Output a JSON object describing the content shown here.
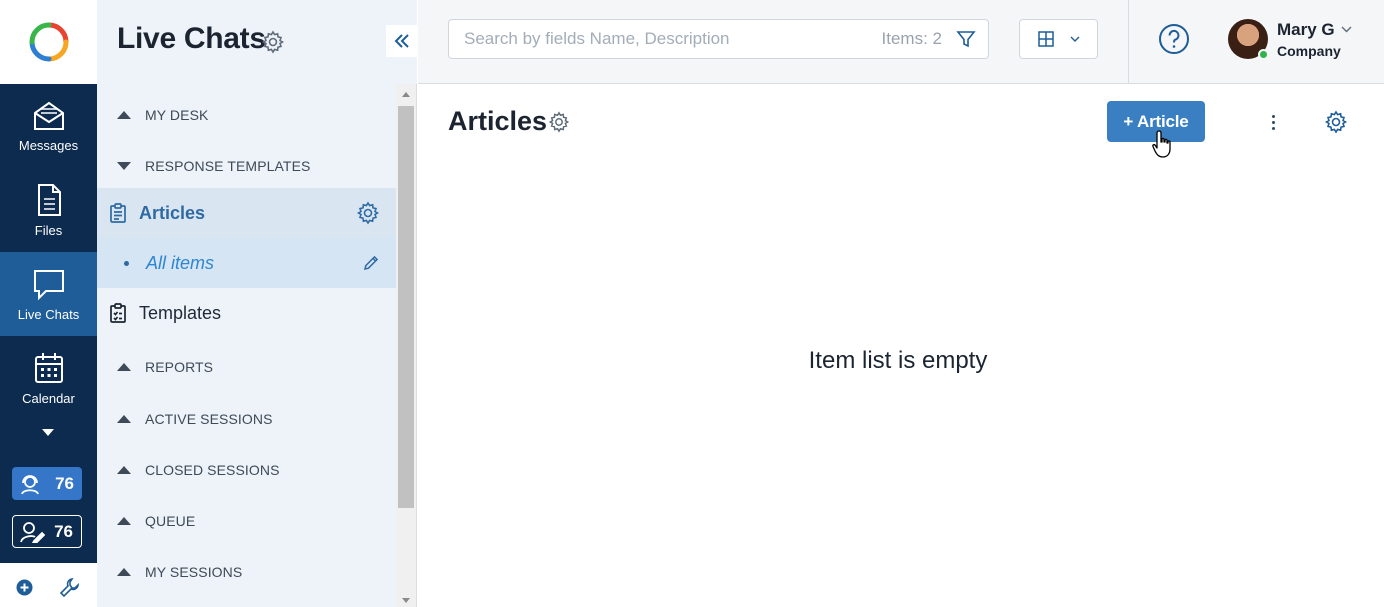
{
  "rail": {
    "items": [
      {
        "label": "Messages",
        "icon": "envelope-icon"
      },
      {
        "label": "Files",
        "icon": "file-icon"
      },
      {
        "label": "Live Chats",
        "icon": "chat-bubble-icon",
        "active": true
      },
      {
        "label": "Calendar",
        "icon": "calendar-icon"
      }
    ],
    "badges": [
      {
        "icon": "operator-headset-icon",
        "count": "76"
      },
      {
        "icon": "user-edit-icon",
        "count": "76"
      }
    ]
  },
  "nav": {
    "title": "Live Chats",
    "items": [
      {
        "type": "section",
        "label": "MY DESK",
        "state": "collapsed"
      },
      {
        "type": "section",
        "label": "RESPONSE TEMPLATES",
        "state": "expanded"
      },
      {
        "type": "page",
        "label": "Articles",
        "selected": true
      },
      {
        "type": "sub",
        "label": "All items"
      },
      {
        "type": "page",
        "label": "Templates"
      },
      {
        "type": "section",
        "label": "REPORTS",
        "state": "collapsed"
      },
      {
        "type": "section",
        "label": "ACTIVE SESSIONS",
        "state": "collapsed"
      },
      {
        "type": "section",
        "label": "CLOSED SESSIONS",
        "state": "collapsed"
      },
      {
        "type": "section",
        "label": "QUEUE",
        "state": "collapsed"
      },
      {
        "type": "section",
        "label": "MY SESSIONS",
        "state": "collapsed"
      }
    ]
  },
  "search": {
    "placeholder": "Search by fields Name, Description",
    "value": "",
    "items_count": "Items: 2"
  },
  "user": {
    "name": "Mary G",
    "company": "Company",
    "status_color": "#2fb34a"
  },
  "main": {
    "title": "Articles",
    "add_button": "+ Article",
    "empty_message": "Item list is empty"
  },
  "colors": {
    "rail_bg": "#0c2b4e",
    "rail_active": "#1e5d97",
    "accent": "#3a7fc1",
    "nav_bg": "#eef3f9",
    "nav_selected": "#d9e6f2"
  }
}
